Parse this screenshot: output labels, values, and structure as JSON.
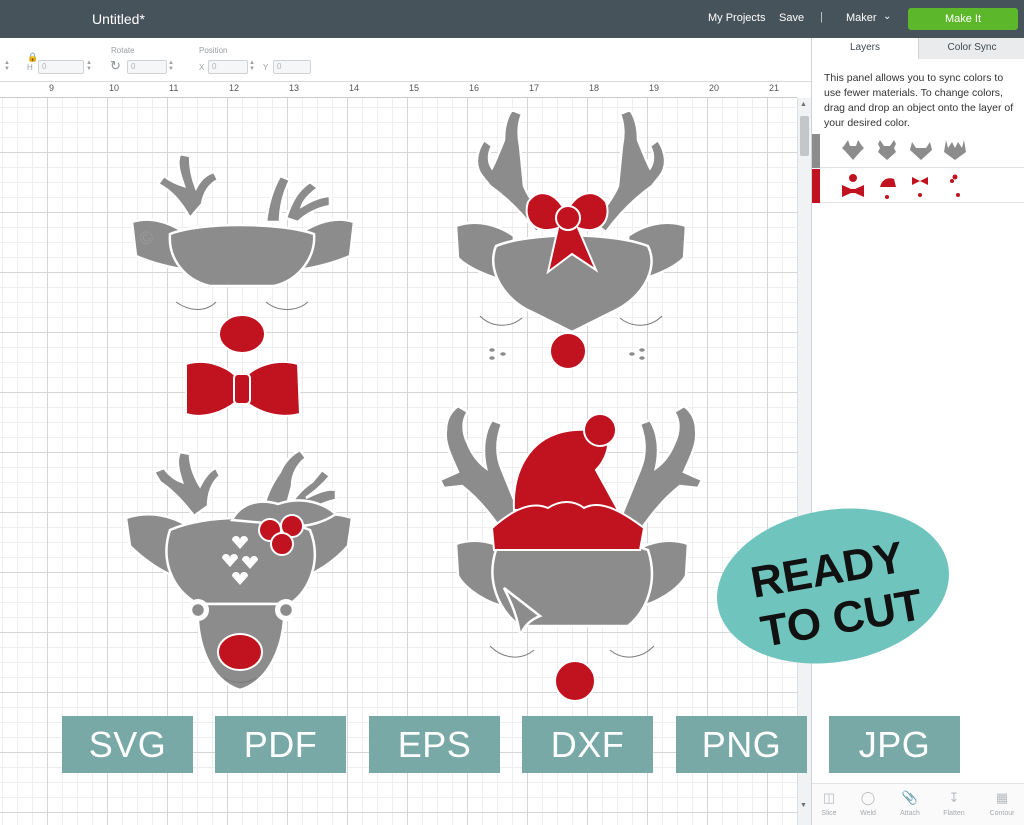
{
  "topbar": {
    "title": "Untitled*",
    "my_projects": "My Projects",
    "save": "Save",
    "separator": "|",
    "maker": "Maker",
    "make_it": "Make It"
  },
  "editbar": {
    "h_label": "H",
    "h_value": "0",
    "rotate_label": "Rotate",
    "rotate_value": "0",
    "position_label": "Position",
    "x_label": "X",
    "x_value": "0",
    "y_label": "Y",
    "y_value": "0"
  },
  "ruler": {
    "numbers": [
      "9",
      "10",
      "11",
      "12",
      "13",
      "14",
      "15",
      "16",
      "17",
      "18",
      "19",
      "20",
      "21"
    ]
  },
  "panel": {
    "tabs": [
      "Layers",
      "Color Sync"
    ],
    "active_tab": "Color Sync",
    "description": "This panel allows you to sync colors to use fewer materials. To change colors, drag and drop an object onto the layer of your desired color.",
    "color_groups": [
      {
        "color": "#8c8c8c",
        "items": 4
      },
      {
        "color": "#c0121f",
        "items": 4
      }
    ]
  },
  "bottom_tools": [
    "Slice",
    "Weld",
    "Attach",
    "Flatten",
    "Contour"
  ],
  "badge": {
    "line1": "READY",
    "line2": "TO CUT",
    "color": "#6fc4bd"
  },
  "formats": [
    "SVG",
    "PDF",
    "EPS",
    "DXF",
    "PNG",
    "JPG"
  ],
  "colors": {
    "topbar": "#47535b",
    "make_it": "#5cb82a",
    "gray_fill": "#8c8c8c",
    "red_fill": "#c0121f",
    "format_box": "#78a9a6"
  }
}
